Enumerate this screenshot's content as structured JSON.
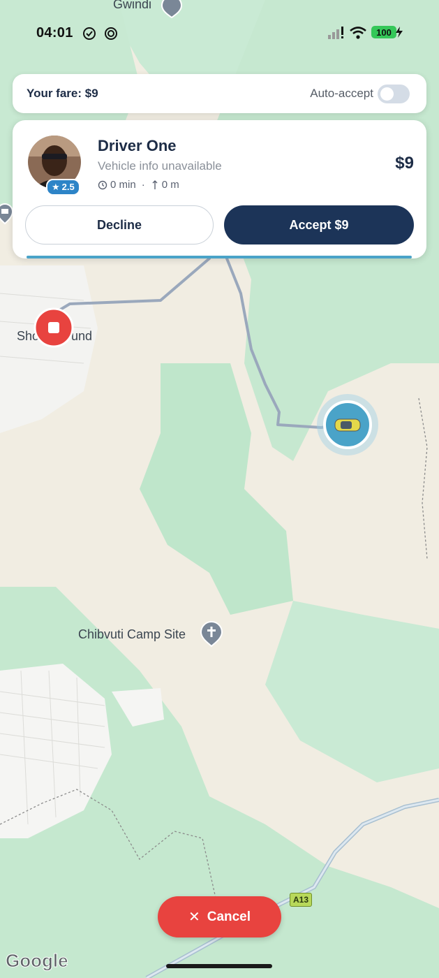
{
  "status_bar": {
    "time": "04:01",
    "battery": "100"
  },
  "fare_card": {
    "fare_label": "Your fare: $9",
    "auto_accept_label": "Auto-accept",
    "auto_accept_on": false
  },
  "offer": {
    "driver_name": "Driver One",
    "vehicle_info": "Vehicle info unavailable",
    "rating": "2.5",
    "eta": "0 min",
    "separator": "·",
    "distance": "0 m",
    "price": "$9",
    "decline_label": "Decline",
    "accept_label": "Accept $9"
  },
  "map": {
    "labels": {
      "top_place": "Gwindi",
      "left_place_a": "Sho",
      "left_place_b": "und",
      "camp_site": "Chibvuti Camp Site",
      "road_shield": "A13"
    },
    "attribution": "Google"
  },
  "cancel_label": "Cancel",
  "colors": {
    "primary": "#1c3458",
    "danger": "#e8433f",
    "accent": "#2d84c7",
    "progress": "#4aa3c8"
  }
}
